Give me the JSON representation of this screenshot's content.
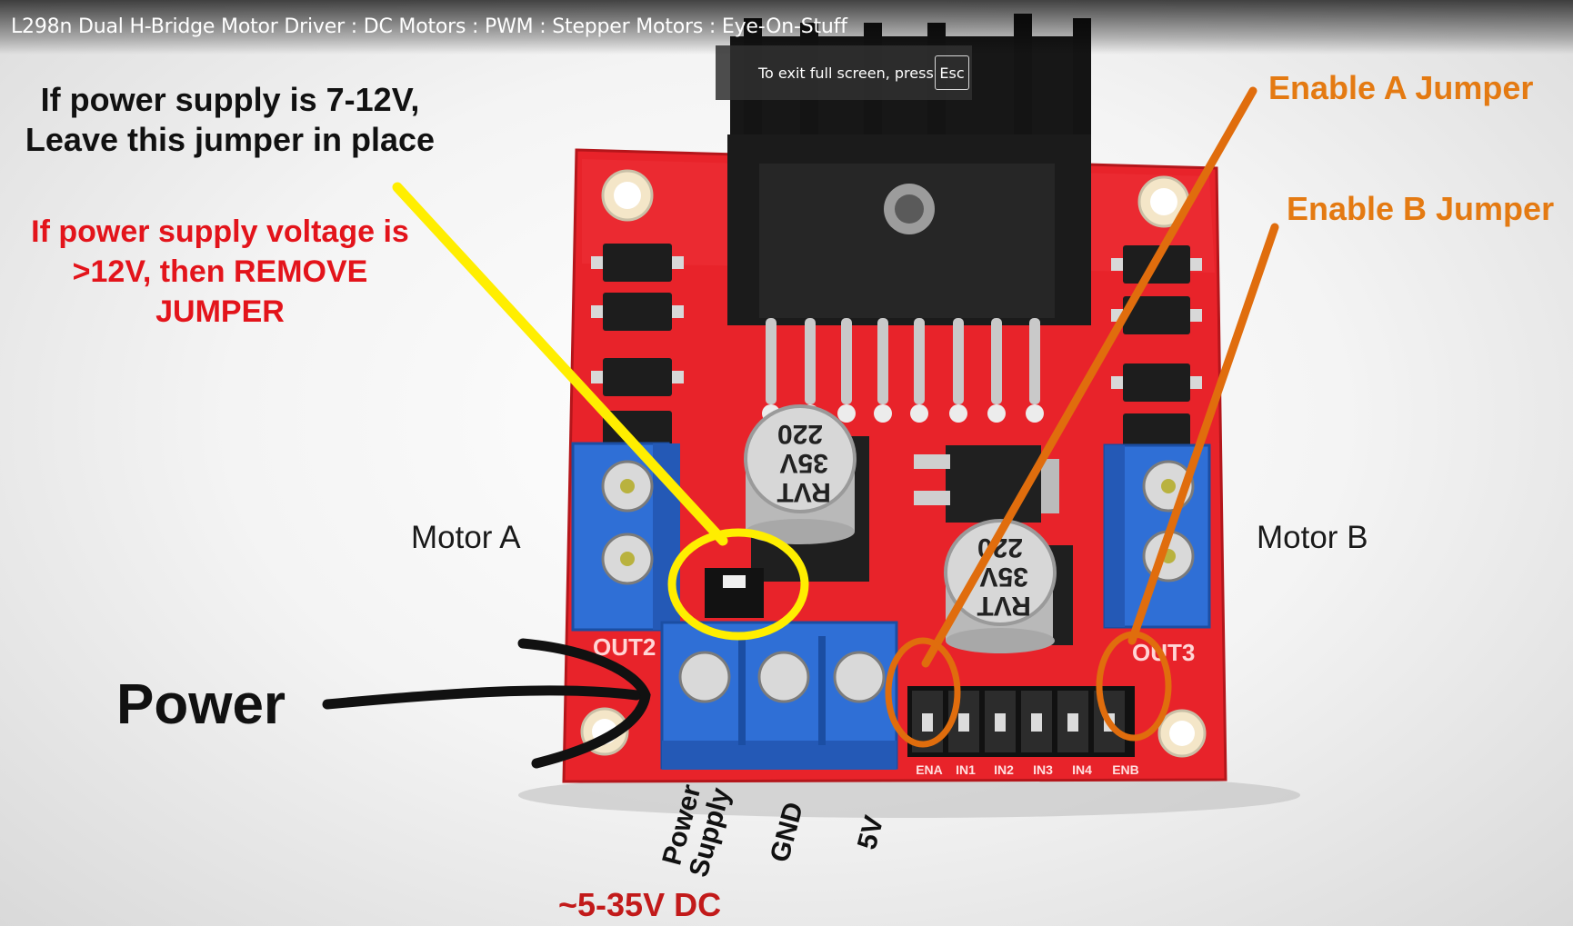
{
  "video": {
    "title": "L298n Dual H-Bridge Motor Driver : DC Motors : PWM : Stepper Motors : Eye-On-Stuff"
  },
  "fullscreen_toast": {
    "message": "To exit full screen, press",
    "key": "Esc"
  },
  "annotations": {
    "jumper_keep_line1": "If power supply is 7-12V,",
    "jumper_keep_line2": "Leave this jumper in place",
    "jumper_remove_line1": "If power supply voltage is",
    "jumper_remove_line2": ">12V, then REMOVE",
    "jumper_remove_line3": "JUMPER",
    "enable_a": "Enable A Jumper",
    "enable_b": "Enable B Jumper",
    "motor_a": "Motor A",
    "motor_b": "Motor B",
    "power": "Power",
    "power_supply_line1": "Power",
    "power_supply_line2": "Supply",
    "gnd": "GND",
    "five_v": "5V",
    "supply_range": "~5-35V DC"
  },
  "board": {
    "cap_value": "220",
    "cap_voltage": "35V",
    "cap_brand": "RVT",
    "out_left": "OUT2",
    "out_right": "OUT3",
    "header_pins": [
      "ENA",
      "IN1",
      "IN2",
      "IN3",
      "IN4",
      "ENB"
    ]
  },
  "colors": {
    "pcb": "#e8232a",
    "terminal_blue": "#2f6fd6",
    "highlight_yellow": "#ffee00",
    "highlight_orange": "#e06d0d",
    "arrow_black": "#111111"
  }
}
